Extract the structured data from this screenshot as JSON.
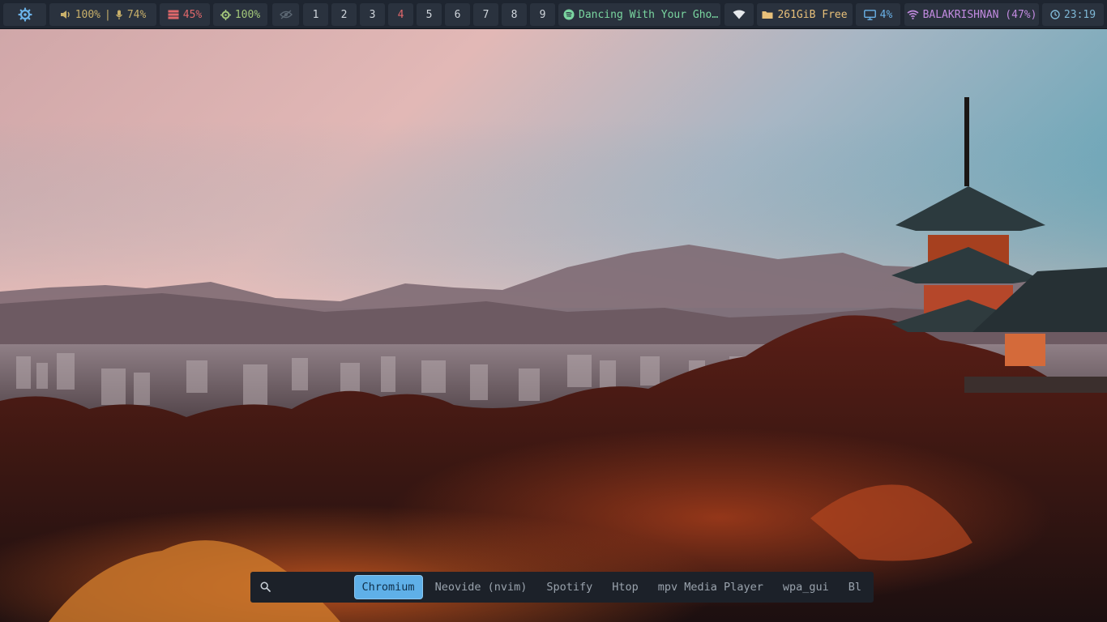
{
  "launcher_icon": "gear-flower-icon",
  "audio": {
    "volume": "100%",
    "separator": "|",
    "mic": "74%"
  },
  "memory": "45%",
  "cpu": "100%",
  "workspaces": [
    "1",
    "2",
    "3",
    "4",
    "5",
    "6",
    "7",
    "8",
    "9"
  ],
  "urgent_workspace": "4",
  "media": {
    "track": "Dancing With Your Gho…"
  },
  "storage": "261GiB Free",
  "backlight": "4%",
  "wifi": "BALAKRISHNAN (47%)",
  "clock": "23:19",
  "app_launcher": {
    "query": "",
    "results": [
      "Chromium",
      "Neovide (nvim)",
      "Spotify",
      "Htop",
      "mpv Media Player",
      "wpa_gui",
      "Bl"
    ],
    "selected": "Chromium"
  },
  "colors": {
    "bar_bg": "#1e2530",
    "module_bg": "#2a323e",
    "volume": "#c9b06a",
    "memory": "#e0686b",
    "cpu": "#a3c77a",
    "spotify": "#7ad6a0",
    "storage": "#e8c07a",
    "backlight": "#6bb2e8",
    "wifi": "#c28be0",
    "clock": "#7fb8d6",
    "launcher_highlight": "#5fb0e8"
  }
}
